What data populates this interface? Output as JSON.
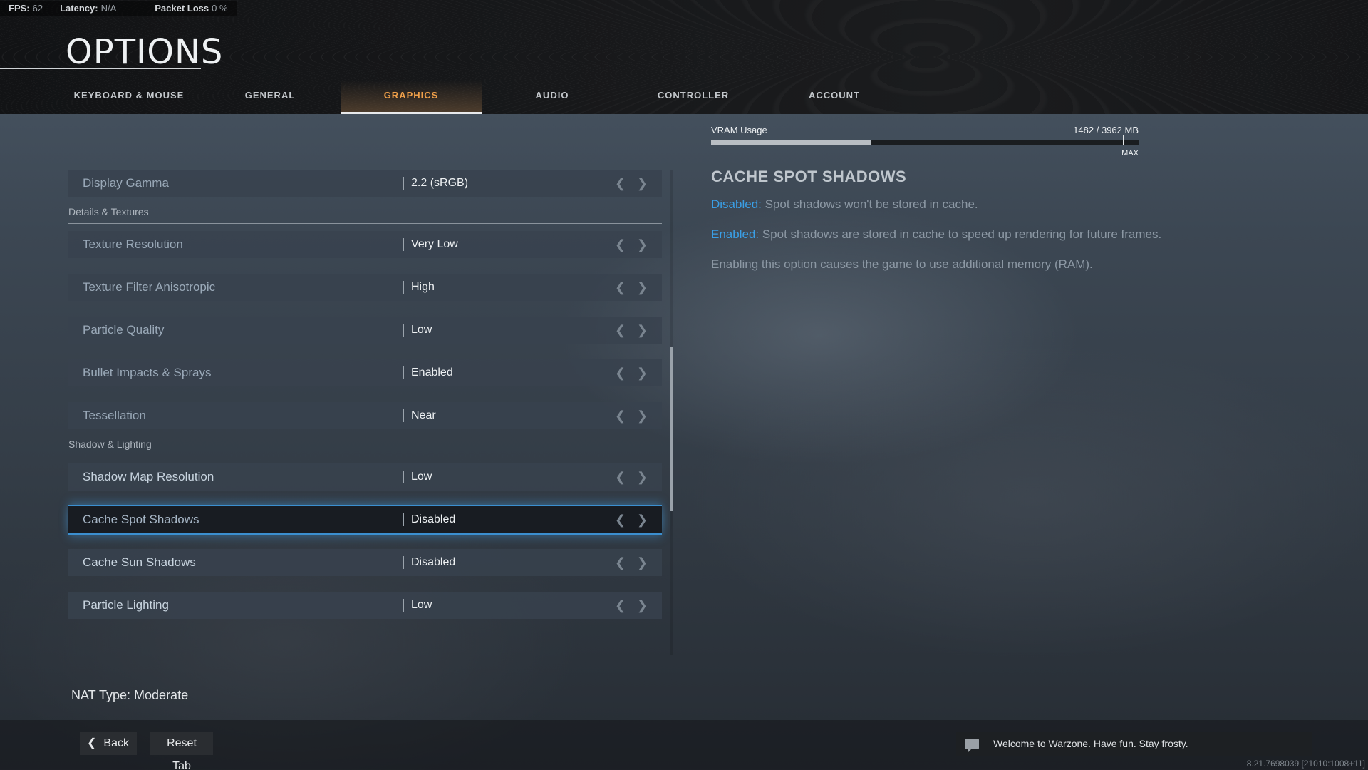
{
  "stats": [
    {
      "label": "FPS:",
      "value": "62"
    },
    {
      "label": "Latency:",
      "value": "N/A"
    },
    {
      "label": "Packet Loss",
      "value": "0  %"
    }
  ],
  "title": "OPTIONS",
  "tabs": [
    "KEYBOARD & MOUSE",
    "GENERAL",
    "GRAPHICS",
    "AUDIO",
    "CONTROLLER",
    "ACCOUNT"
  ],
  "active_tab": "GRAPHICS",
  "settings": {
    "display_gamma": {
      "label": "Display Gamma",
      "value": "2.2 (sRGB)"
    },
    "section_details": "Details & Textures",
    "texture_resolution": {
      "label": "Texture Resolution",
      "value": "Very Low"
    },
    "texture_filter": {
      "label": "Texture Filter Anisotropic",
      "value": "High"
    },
    "particle_quality": {
      "label": "Particle Quality",
      "value": "Low"
    },
    "bullet_impacts": {
      "label": "Bullet Impacts & Sprays",
      "value": "Enabled"
    },
    "tessellation": {
      "label": "Tessellation",
      "value": "Near"
    },
    "section_shadow": "Shadow & Lighting",
    "shadow_map": {
      "label": "Shadow Map Resolution",
      "value": "Low"
    },
    "cache_spot": {
      "label": "Cache Spot Shadows",
      "value": "Disabled"
    },
    "cache_sun": {
      "label": "Cache Sun Shadows",
      "value": "Disabled"
    },
    "particle_lighting": {
      "label": "Particle Lighting",
      "value": "Low"
    }
  },
  "vram": {
    "label": "VRAM Usage",
    "usage": "1482 / 3962 MB",
    "used_mb": 1482,
    "total_mb": 3962,
    "max_label": "MAX"
  },
  "detail": {
    "title": "CACHE SPOT SHADOWS",
    "disabled_label": "Disabled:",
    "disabled_text": " Spot shadows won't be stored in cache.",
    "enabled_label": "Enabled:",
    "enabled_text": " Spot shadows are stored in cache to speed up rendering for future frames.",
    "note": "Enabling this option causes the game to use additional memory (RAM)."
  },
  "nat": "NAT Type: Moderate",
  "buttons": {
    "back": "Back",
    "reset": "Reset Tab"
  },
  "chat": "Welcome to Warzone. Have fun. Stay frosty.",
  "build": "8.21.7698039 [21010:1008+11]",
  "colors": {
    "accent_tab": "#f0a04a",
    "highlight_blue": "#3a9fe6",
    "selection_glow": "#3b8fd0"
  },
  "icons": [
    "chevron-left-icon",
    "chevron-right-icon",
    "chat-icon"
  ]
}
